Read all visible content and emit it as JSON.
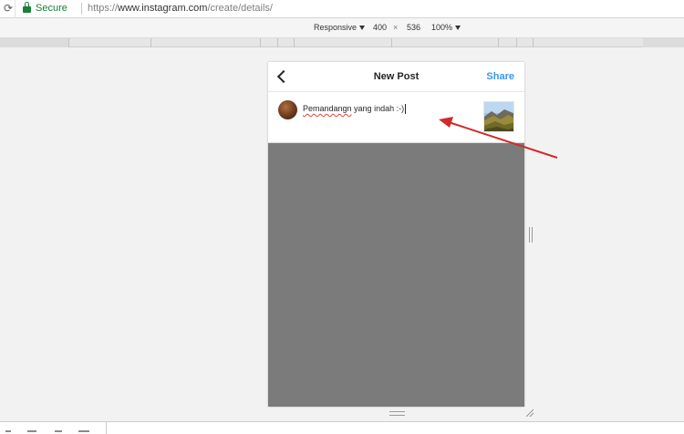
{
  "browser": {
    "reload_glyph": "⟳",
    "secure_label": "Secure",
    "url_scheme": "https://",
    "url_host": "www.instagram.com",
    "url_path": "/create/details/"
  },
  "device_toolbar": {
    "device": "Responsive",
    "width": "400",
    "times": "×",
    "height": "536",
    "zoom": "100%"
  },
  "post": {
    "title": "New Post",
    "share_label": "Share",
    "caption_word1": "Pemandangn",
    "caption_rest": " yang indah :-)"
  },
  "colors": {
    "share": "#3897f0",
    "secure": "#188038",
    "arrow": "#d12a2a",
    "viewport_bg": "#7b7b7b"
  },
  "icons": [
    "reload-icon",
    "lock-icon",
    "back-arrow-icon",
    "caret-down-icon",
    "resize-handle-icon"
  ]
}
